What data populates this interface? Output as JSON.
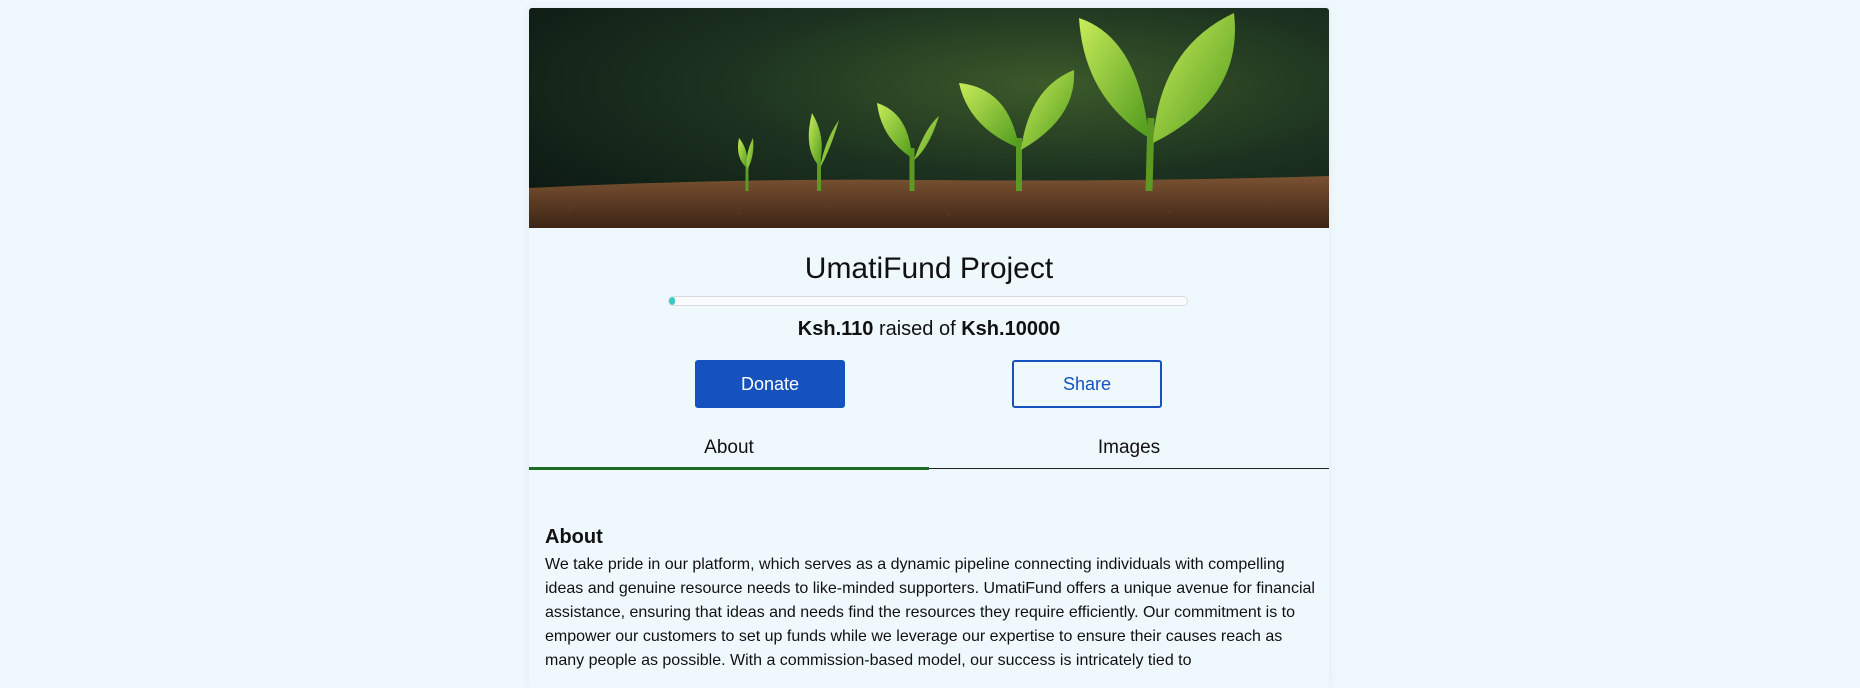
{
  "project": {
    "title": "UmatiFund Project",
    "hero_image": "seedlings-growing-photo"
  },
  "funding": {
    "raised_amount": "Ksh.110",
    "raised_connector": "raised of",
    "goal_amount": "Ksh.10000",
    "progress_fraction": 0.011
  },
  "actions": {
    "donate_label": "Donate",
    "share_label": "Share"
  },
  "tabs": [
    {
      "label": "About",
      "active": true
    },
    {
      "label": "Images",
      "active": false
    }
  ],
  "about": {
    "heading": "About",
    "body": "We take pride in our platform, which serves as a dynamic pipeline connecting individuals with compelling ideas and genuine resource needs to like-minded supporters. UmatiFund offers a unique avenue for financial assistance, ensuring that ideas and needs find the resources they require efficiently. Our commitment is to empower our customers to set up funds while we leverage our expertise to ensure their causes reach as many people as possible. With a commission-based model, our success is intricately tied to"
  },
  "colors": {
    "page_background": "#eff8fc",
    "primary": "#1552bd",
    "progress_fill": "#3cc7c0",
    "tab_active_underline": "#1d6b24"
  }
}
